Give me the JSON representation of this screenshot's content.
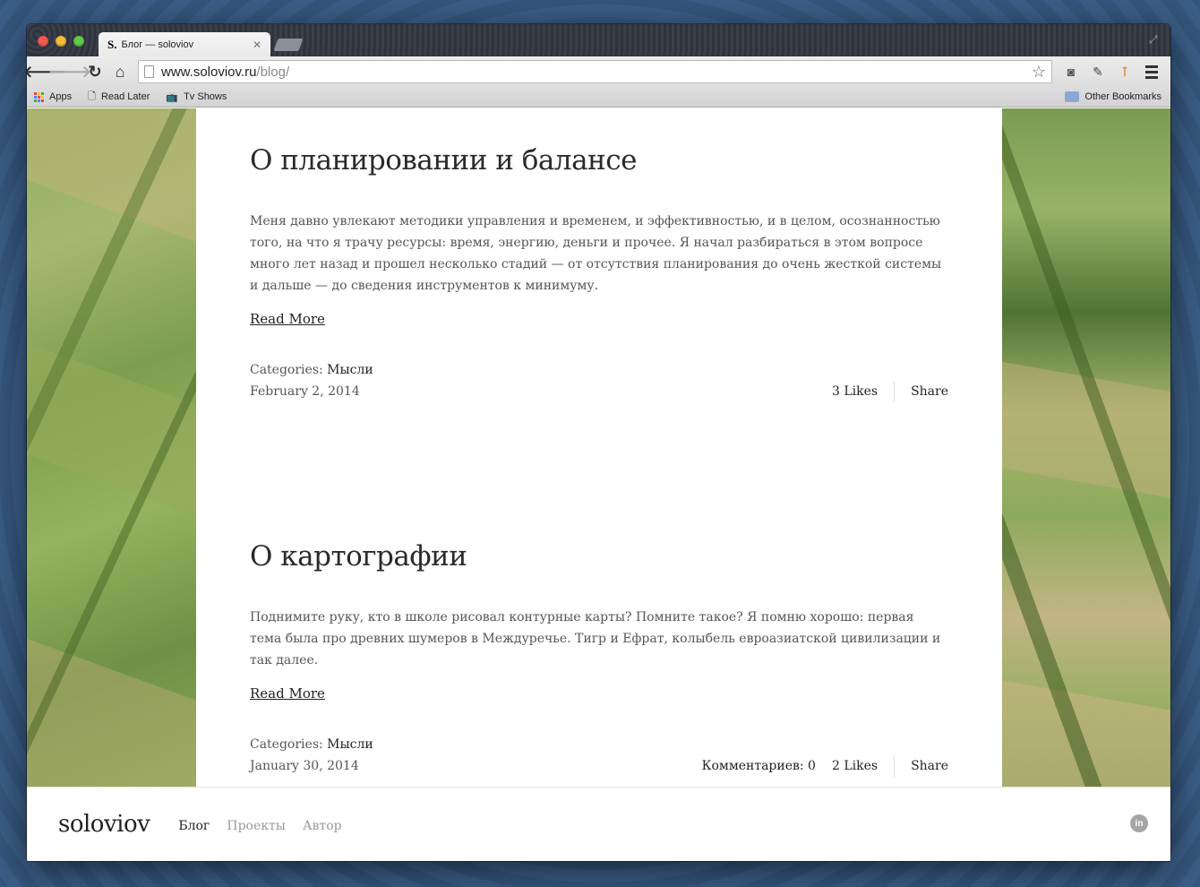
{
  "browser": {
    "tab_favicon": "S.",
    "tab_title": "Блог — soloviov",
    "tab_close": "✕",
    "url_host": "www.soloviov.ru",
    "url_path": "/blog/",
    "back_icon": "arrow-left-icon",
    "forward_icon": "arrow-right-icon",
    "reload_icon": "reload-icon",
    "home_icon": "home-icon"
  },
  "bookmarks": {
    "apps_label": "Apps",
    "items": [
      {
        "label": "Read Later"
      },
      {
        "label": "Tv Shows"
      }
    ],
    "other_label": "Other Bookmarks"
  },
  "posts": [
    {
      "title": "О планировании и балансе",
      "excerpt": "Меня давно увлекают методики управления и временем, и эффективностью, и в целом, осознанностью того, на что я трачу ресурсы: время, энергию, деньги и прочее. Я начал разбираться в этом вопросе много лет назад и прошел несколько стадий — от отсутствия планирования до очень жесткой системы и дальше — до сведения инструментов к минимуму.",
      "read_more": "Read More",
      "categories_label": "Categories:",
      "category": "Мысли",
      "date": "February 2, 2014",
      "comments": "",
      "likes": "3 Likes",
      "share": "Share"
    },
    {
      "title": "О картографии",
      "excerpt": "Поднимите руку, кто в школе рисовал контурные карты? Помните такое? Я помню хорошо: первая тема была про древних шумеров в Междуречье. Тигр и Ефрат, колыбель евроазиатской цивилизации и так далее.",
      "read_more": "Read More",
      "categories_label": "Categories:",
      "category": "Мысли",
      "date": "January 30, 2014",
      "comments": "Комментариев: 0",
      "likes": "2 Likes",
      "share": "Share"
    }
  ],
  "footer": {
    "logo": "soloviov",
    "nav": [
      {
        "label": "Блог"
      },
      {
        "label": "Проекты"
      },
      {
        "label": "Автор"
      }
    ],
    "social_label": "in"
  }
}
